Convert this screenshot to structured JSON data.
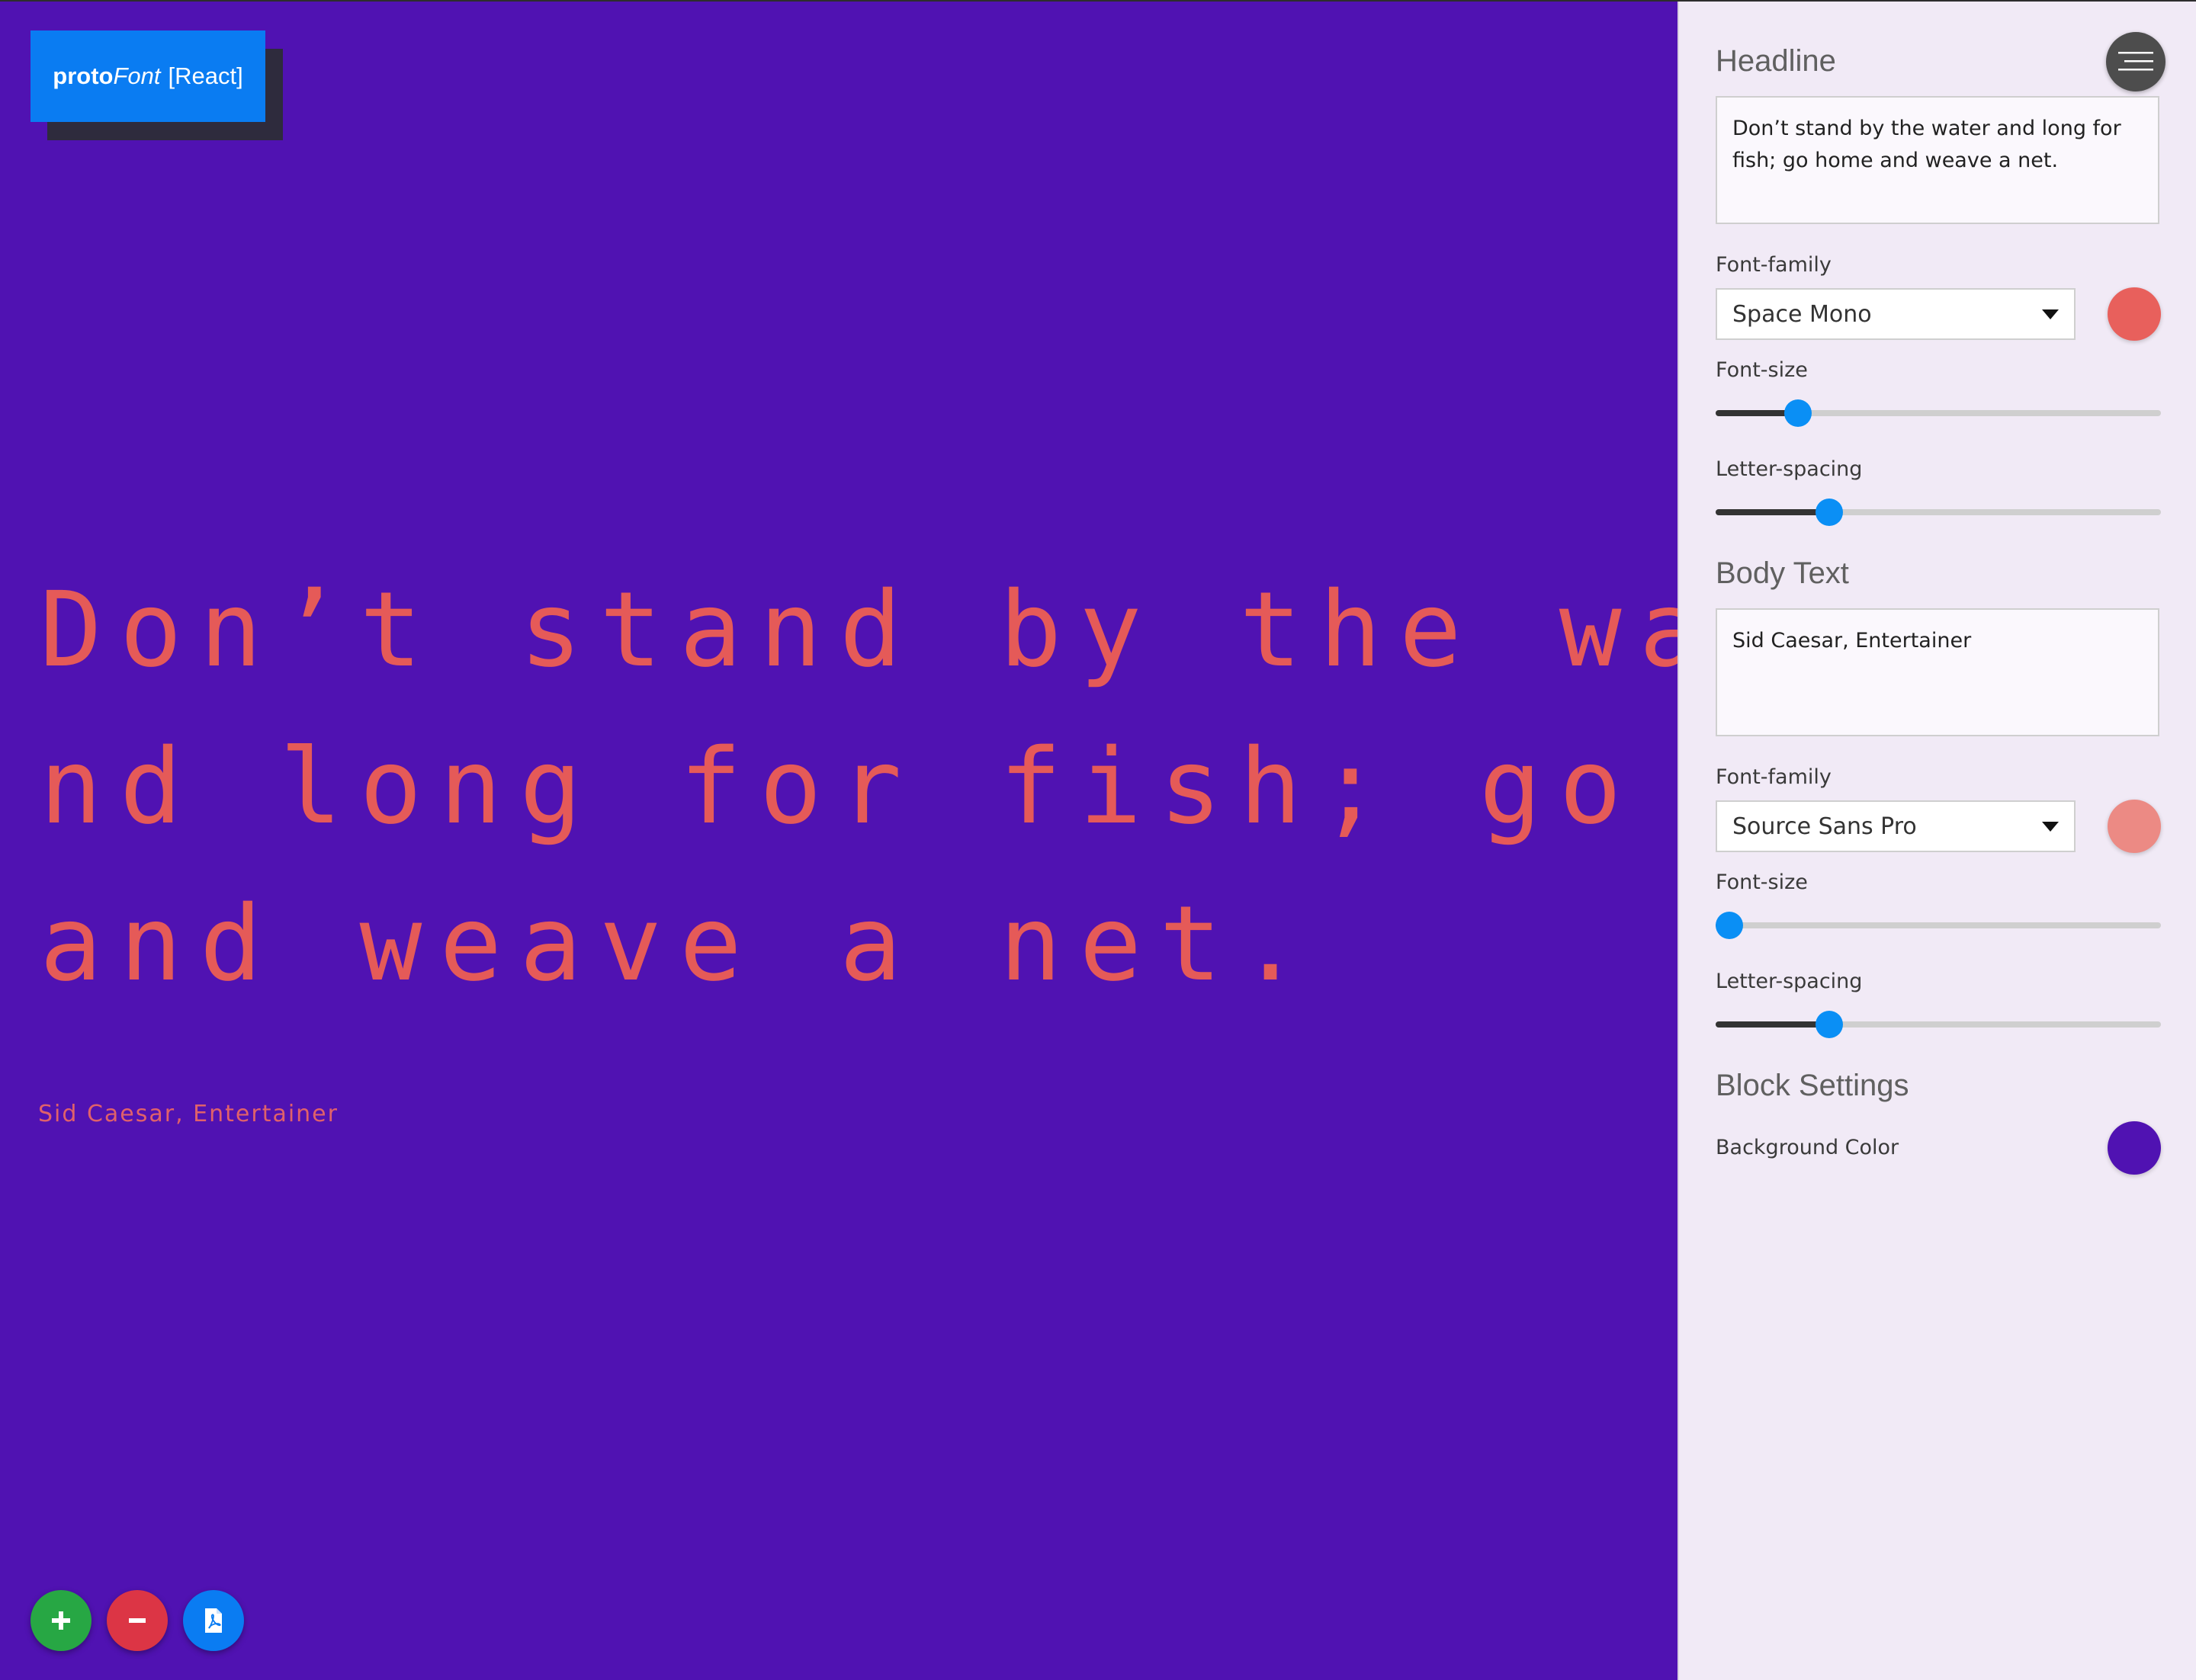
{
  "app": {
    "logo_bold": "proto",
    "logo_italic": "Font",
    "logo_suffix": "[React]"
  },
  "preview": {
    "headline": "Don’t stand by the water and long for fish; go home and weave a net.",
    "body": "Sid Caesar, Entertainer"
  },
  "actions": {
    "add_icon": "plus-icon",
    "remove_icon": "minus-icon",
    "export_icon": "pdf-file-icon"
  },
  "panel": {
    "menu_icon": "hamburger-icon",
    "headline": {
      "title": "Headline",
      "text": "Don’t stand by the water and long for fish; go home and weave a net.",
      "font_family_label": "Font-family",
      "font_family": "Space Mono",
      "color": "#e8605c",
      "font_size_label": "Font-size",
      "font_size_level": 0.185,
      "letter_spacing_label": "Letter-spacing",
      "letter_spacing_level": 0.255
    },
    "body": {
      "title": "Body Text",
      "text": "Sid Caesar, Entertainer",
      "font_family_label": "Font-family",
      "font_family": "Source Sans Pro",
      "color": "#ec8a84",
      "font_size_label": "Font-size",
      "font_size_level": 0.03,
      "letter_spacing_label": "Letter-spacing",
      "letter_spacing_level": 0.255
    },
    "block": {
      "title": "Block Settings",
      "background_label": "Background Color",
      "background_color": "#5012b2"
    }
  }
}
